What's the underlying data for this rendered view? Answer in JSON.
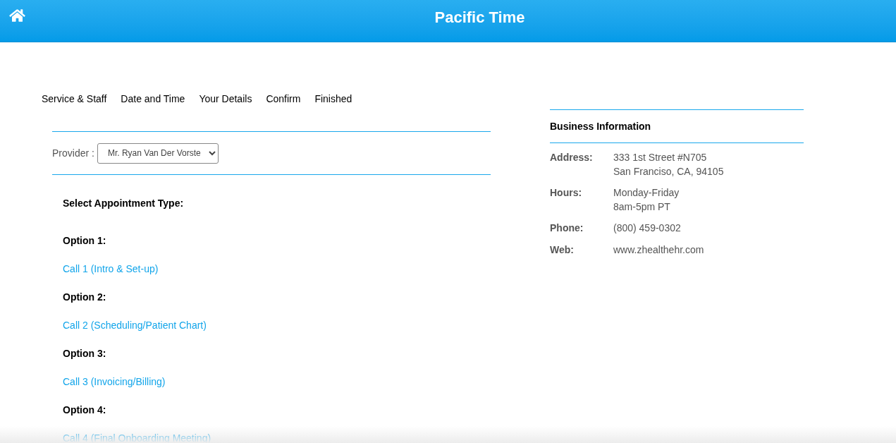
{
  "header": {
    "title": "Pacific Time"
  },
  "steps": [
    "Service & Staff",
    "Date and Time",
    "Your Details",
    "Confirm",
    "Finished"
  ],
  "provider": {
    "label": "Provider :",
    "value": "Mr. Ryan Van Der Vorste"
  },
  "appointment": {
    "heading": "Select Appointment Type:",
    "options": [
      {
        "label": "Option 1:",
        "link": "Call 1 (Intro & Set-up)"
      },
      {
        "label": "Option 2:",
        "link": "Call 2 (Scheduling/Patient Chart)"
      },
      {
        "label": "Option 3:",
        "link": "Call 3 (Invoicing/Billing)"
      },
      {
        "label": "Option 4:",
        "link": "Call 4 (Final Onboarding Meeting)"
      }
    ]
  },
  "business": {
    "title": "Business Information",
    "rows": [
      {
        "label": "Address:",
        "lines": [
          "333 1st Street #N705",
          "San Franciso, CA, 94105"
        ]
      },
      {
        "label": "Hours:",
        "lines": [
          "Monday-Friday",
          "8am-5pm PT"
        ]
      },
      {
        "label": "Phone:",
        "lines": [
          "(800) 459-0302"
        ]
      },
      {
        "label": "Web:",
        "lines": [
          "www.zhealthehr.com"
        ]
      }
    ]
  }
}
